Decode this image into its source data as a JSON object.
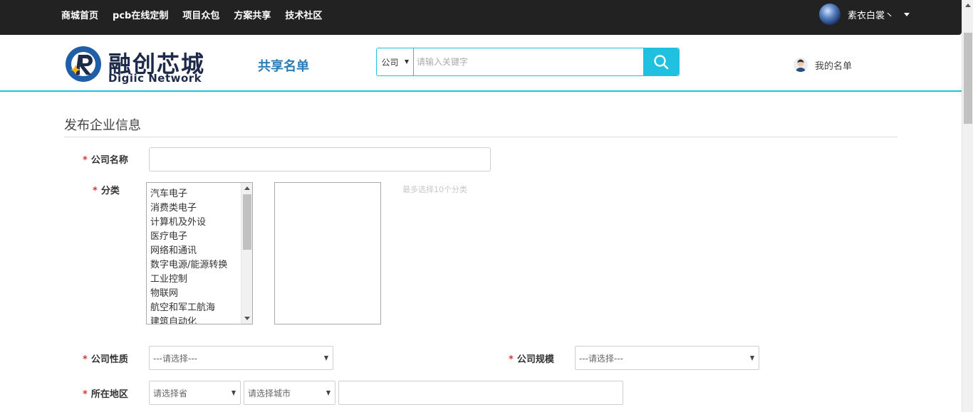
{
  "topnav": {
    "items": [
      "商城首页",
      "pcb在线定制",
      "项目众包",
      "方案共享",
      "技术社区"
    ]
  },
  "user": {
    "name": "素衣白裳丶"
  },
  "logo": {
    "cn": "融创芯城",
    "en": "Digiic Network"
  },
  "header": {
    "share_list": "共享名单",
    "my_list": "我的名单"
  },
  "search": {
    "scope": "公司",
    "placeholder": "请输入关键字"
  },
  "form": {
    "title": "发布企业信息",
    "required_mark": "*",
    "company_name_label": "公司名称",
    "category_label": "分类",
    "categories": [
      "汽车电子",
      "消费类电子",
      "计算机及外设",
      "医疗电子",
      "网络和通讯",
      "数字电源/能源转换",
      "工业控制",
      "物联网",
      "航空和军工航海",
      "建筑自动化"
    ],
    "category_hint": "最多选择10个分类",
    "nature_label": "公司性质",
    "nature_value": "---请选择---",
    "scale_label": "公司规模",
    "scale_value": "---请选择---",
    "region_label": "所在地区",
    "province_value": "请选择省",
    "city_value": "请选择城市"
  },
  "colors": {
    "topbar": "#222222",
    "accent": "#1fc0e0",
    "share_list": "#2c7cb5",
    "required": "#d23a3a"
  }
}
